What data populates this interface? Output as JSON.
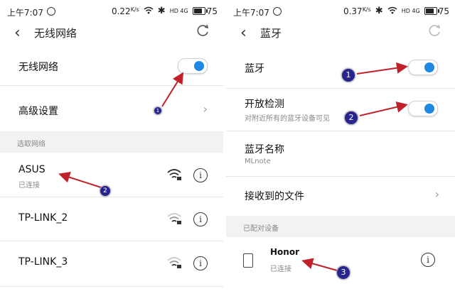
{
  "left": {
    "status": {
      "time": "上午7:07",
      "speed": "0.22",
      "speed_unit": "K/s",
      "sim": "HD 4G",
      "battery": "75"
    },
    "header": {
      "title": "无线网络"
    },
    "rows": [
      {
        "label": "无线网络"
      },
      {
        "label": "高级设置"
      }
    ],
    "section": "选取网络",
    "networks": [
      {
        "name": "ASUS",
        "status": "已连接"
      },
      {
        "name": "TP-LINK_2",
        "status": ""
      },
      {
        "name": "TP-LINK_3",
        "status": ""
      }
    ],
    "badges": [
      "1",
      "2"
    ]
  },
  "right": {
    "status": {
      "time": "上午7:07",
      "speed": "0.37",
      "speed_unit": "K/s",
      "sim": "HD 4G",
      "battery": "75"
    },
    "header": {
      "title": "蓝牙"
    },
    "rows": [
      {
        "label": "蓝牙"
      },
      {
        "label": "开放检测",
        "sub": "对附近所有的蓝牙设备可见"
      },
      {
        "label": "蓝牙名称",
        "sub": "MLnote"
      },
      {
        "label": "接收到的文件"
      }
    ],
    "section": "已配对设备",
    "device": {
      "name": "Honor",
      "status": "已连接"
    },
    "badges": [
      "1",
      "2",
      "3"
    ]
  },
  "colors": {
    "accent": "#1f88e5",
    "arrow": "#c0202a",
    "badge": "#27238f"
  }
}
